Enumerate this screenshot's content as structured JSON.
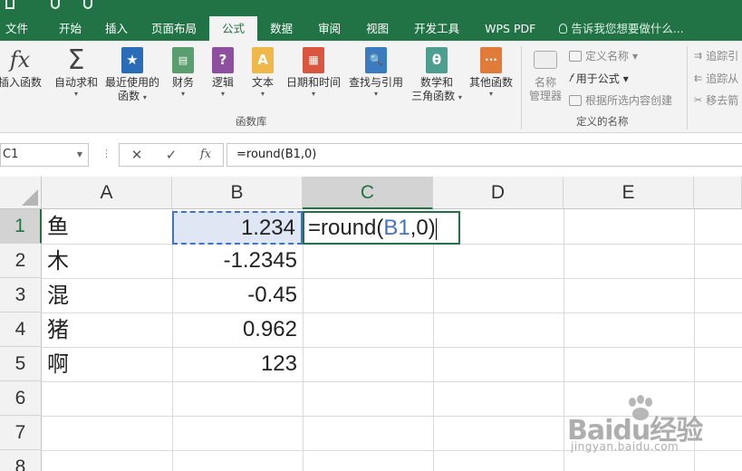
{
  "ribbon": {
    "tabs": [
      "文件",
      "开始",
      "插入",
      "页面布局",
      "公式",
      "数据",
      "审阅",
      "视图",
      "开发工具",
      "WPS PDF"
    ],
    "active_tab": "公式",
    "tell_me": "告诉我您想要做什么...",
    "buttons": {
      "insert_function": "插入函数",
      "autosum": "自动求和",
      "recent_1": "最近使用的",
      "recent_2": "函数",
      "financial": "财务",
      "logical": "逻辑",
      "text": "文本",
      "datetime": "日期和时间",
      "lookup": "查找与引用",
      "math_1": "数学和",
      "math_2": "三角函数",
      "more": "其他函数",
      "name_manager_1": "名称",
      "name_manager_2": "管理器"
    },
    "groups": {
      "function_library": "函数库",
      "defined_names": "定义的名称"
    },
    "small_commands": {
      "define_name": "定义名称",
      "use_in_formula": "用于公式",
      "create_from_selection": "根据所选内容创建",
      "trace_precedents": "追踪引",
      "trace_dependents": "追踪从",
      "remove_arrows": "移去箭"
    },
    "icon_glyphs": {
      "fx": "fx",
      "sigma": "Σ",
      "star": "★",
      "question": "?",
      "text_a": "A",
      "lookup": "🔍",
      "theta": "θ",
      "more": "···"
    }
  },
  "formula_bar": {
    "name_box": "C1",
    "cancel": "✕",
    "enter": "✓",
    "fx": "fx",
    "formula": "=round(B1,0)"
  },
  "sheet": {
    "columns": [
      "A",
      "B",
      "C",
      "D",
      "E"
    ],
    "selected_column": "C",
    "rows": [
      "1",
      "2",
      "3",
      "4",
      "5",
      "6",
      "7",
      "8"
    ],
    "selected_row": "1",
    "col_a": [
      "鱼",
      "木",
      "混",
      "猪",
      "啊"
    ],
    "col_b": [
      "1.234",
      "-1.2345",
      "-0.45",
      "0.962",
      "123"
    ],
    "c1_edit": {
      "prefix": "=round(",
      "ref": "B1",
      "suffix": ",0)"
    }
  },
  "watermark": {
    "brand": "Baidu经验",
    "url": "jingyan.baidu.com"
  },
  "colors": {
    "excel_green": "#217346",
    "ref_blue": "#4472c4"
  }
}
